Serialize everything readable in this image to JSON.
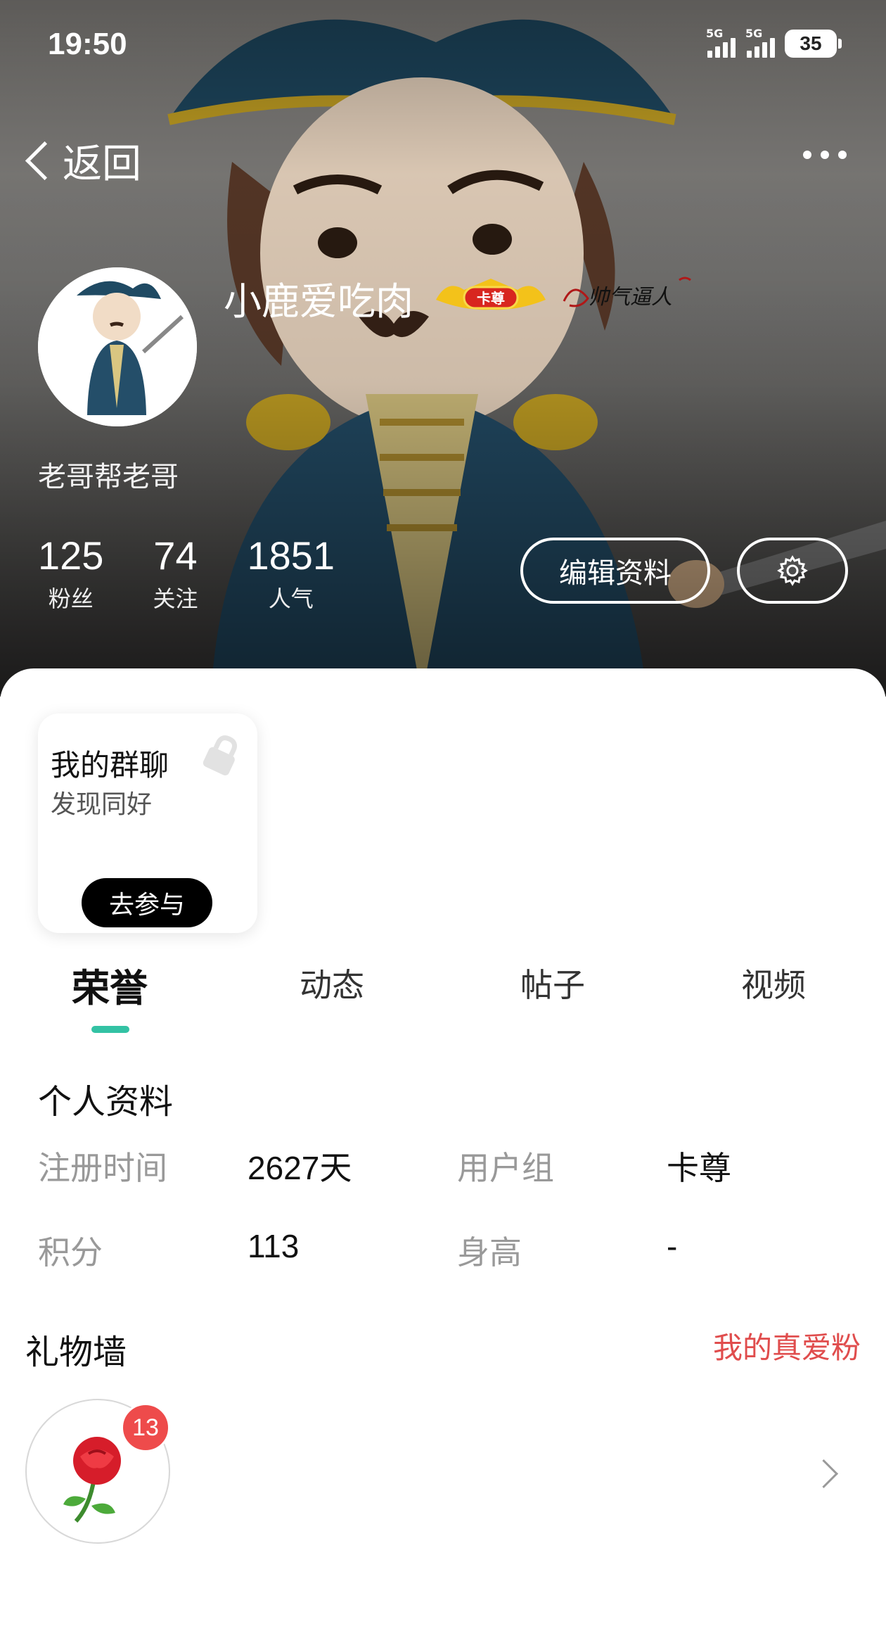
{
  "status_bar": {
    "time": "19:50",
    "network_1": "5G",
    "network_2": "5G",
    "battery": "35"
  },
  "nav": {
    "back_label": "返回",
    "more_icon": "more-dots-icon"
  },
  "profile": {
    "username": "小鹿爱吃肉",
    "vip_badge": "卡尊",
    "signature_art": "帅气逼人",
    "signature": "老哥帮老哥",
    "stats": [
      {
        "value": "125",
        "label": "粉丝"
      },
      {
        "value": "74",
        "label": "关注"
      },
      {
        "value": "1851",
        "label": "人气"
      }
    ],
    "edit_label": "编辑资料",
    "settings_icon": "gear-icon"
  },
  "group_chat": {
    "title": "我的群聊",
    "subtitle": "发现同好",
    "join_label": "去参与",
    "lock_icon": "lock-icon"
  },
  "tabs": [
    {
      "label": "荣誉",
      "active": true
    },
    {
      "label": "动态",
      "active": false
    },
    {
      "label": "帖子",
      "active": false
    },
    {
      "label": "视频",
      "active": false
    }
  ],
  "personal_info": {
    "title": "个人资料",
    "rows": [
      {
        "label1": "注册时间",
        "value1": "2627天",
        "label2": "用户组",
        "value2": "卡尊"
      },
      {
        "label1": "积分",
        "value1": "113",
        "label2": "身高",
        "value2": "-"
      }
    ]
  },
  "gift_wall": {
    "title": "礼物墙",
    "link": "我的真爱粉",
    "gift_icon": "rose-icon",
    "gift_count": "13"
  },
  "colors": {
    "accent": "#33c2a4",
    "link_red": "#e04d4d",
    "badge_red": "#ee4b4b"
  }
}
